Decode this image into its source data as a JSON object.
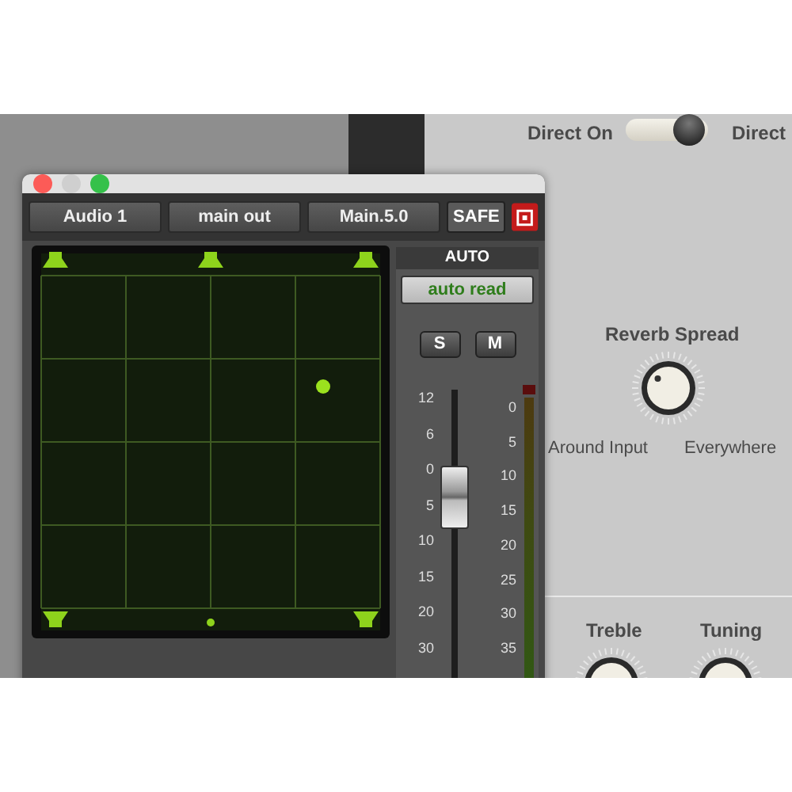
{
  "plugin": {
    "direct_toggle": {
      "label": "Direct On",
      "on": true,
      "label_right": "Direct"
    },
    "reverb_spread": {
      "label": "Reverb Spread",
      "min_label": "Around Input",
      "max_label": "Everywhere"
    },
    "knobs": [
      {
        "label": "Treble"
      },
      {
        "label": "Tuning"
      }
    ]
  },
  "output_window": {
    "selectors": [
      {
        "label": "Audio 1"
      },
      {
        "label": "main out"
      },
      {
        "label": "Main.5.0"
      }
    ],
    "safe_button": "SAFE",
    "automation": {
      "header": "AUTO",
      "mode": "auto read"
    },
    "solo_button": "S",
    "mute_button": "M",
    "fader": {
      "level": 0.66,
      "scale": [
        "12",
        "6",
        "0",
        "5",
        "10",
        "15",
        "20",
        "30"
      ]
    },
    "meter": {
      "scale": [
        "0",
        "5",
        "10",
        "15",
        "20",
        "25",
        "30",
        "35"
      ]
    }
  }
}
